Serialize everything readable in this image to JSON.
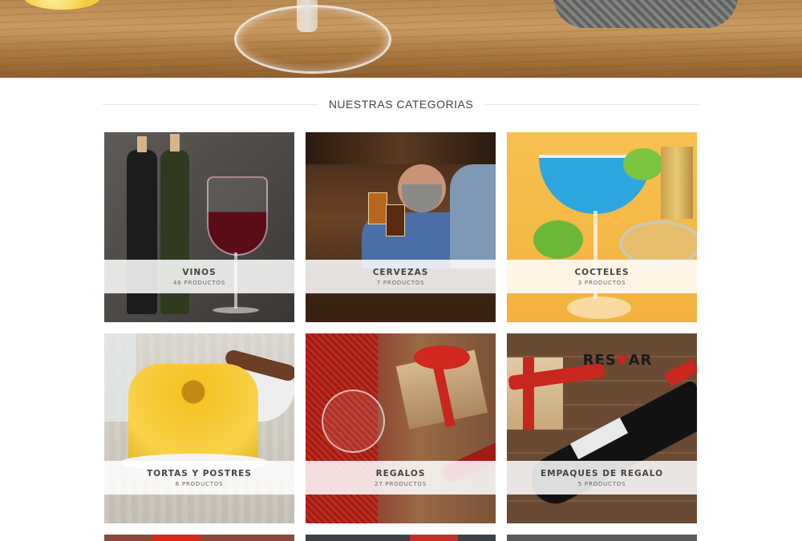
{
  "section": {
    "title": "NUESTRAS CATEGORIAS"
  },
  "categories": [
    {
      "name": "VINOS",
      "count": "46 PRODUCTOS"
    },
    {
      "name": "CERVEZAS",
      "count": "7 PRODUCTOS"
    },
    {
      "name": "COCTELES",
      "count": "3 PRODUCTOS"
    },
    {
      "name": "TORTAS Y POSTRES",
      "count": "6 PRODUCTOS"
    },
    {
      "name": "REGALOS",
      "count": "27 PRODUCTOS"
    },
    {
      "name": "EMPAQUES DE REGALO",
      "count": "5 PRODUCTOS"
    }
  ],
  "brand": {
    "logo_text": "RESTAR",
    "accent": "#c8261e"
  }
}
